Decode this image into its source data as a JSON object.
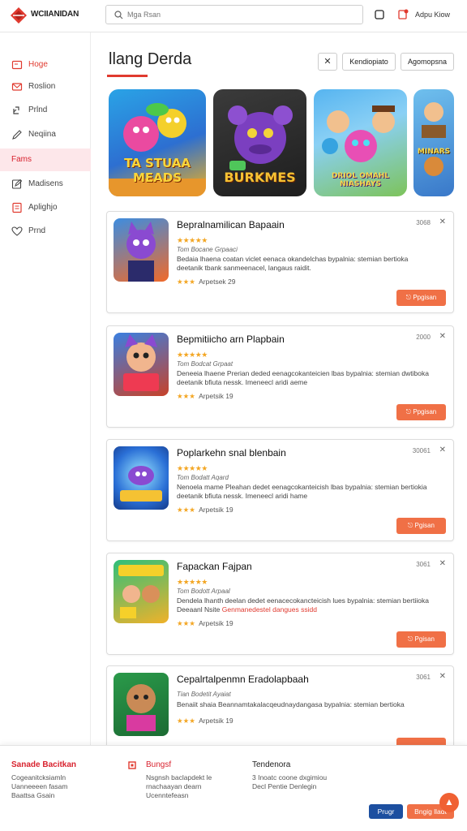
{
  "header": {
    "brand": "WCIIANIDAN",
    "search_placeholder": "Mga Rsan",
    "account_link": "Adpu Kiow"
  },
  "sidebar": {
    "items": [
      {
        "label": "Hoge",
        "icon": "home-icon"
      },
      {
        "label": "Roslion",
        "icon": "mail-icon"
      },
      {
        "label": "Prlnd",
        "icon": "link-icon"
      },
      {
        "label": "Neqiina",
        "icon": "pen-icon"
      },
      {
        "label": "Fams",
        "icon": ""
      },
      {
        "label": "Madisens",
        "icon": "edit-icon"
      },
      {
        "label": "Aplighjo",
        "icon": "document-icon"
      },
      {
        "label": "Prnd",
        "icon": "heart-icon"
      }
    ]
  },
  "main": {
    "title": "llang Derda",
    "buttons": [
      "Kendiopiato",
      "Agomopsna"
    ],
    "featured": [
      {
        "caption": "TA STUAA MEADS"
      },
      {
        "caption": "BURKMES"
      },
      {
        "caption": "DRIOL OMAHL NIASHAYS"
      },
      {
        "caption": "MINARS"
      }
    ],
    "cards": [
      {
        "title": "Bepralnamilican Bapaain",
        "stars": "★★★★★",
        "sub": "Tom Bocane Grpaaci",
        "desc_1": "Bedaia lhaena coatan viclet eenaca okandelchas bypalnia: stemian bertioka",
        "desc_2": "deetanik tbank sanmeenacel, langaus raidit.",
        "desc_highlight": "",
        "rating_stars": "★★★",
        "rating_text": "Arpetsek 29",
        "count": "3068",
        "action": "Ppgisan"
      },
      {
        "title": "Bepmitiicho arn Plapbain",
        "stars": "★★★★★",
        "sub": "Tom Bodcat Grpaat",
        "desc_1": "Deneeia lhaene Prerian deded eenagcokanteicien lbas bypalnia: stemian dwtiboka",
        "desc_2": "deetanik bfiuta nessk. Imeneecl aridi aeme",
        "desc_highlight": "",
        "rating_stars": "★★★",
        "rating_text": "Arpetsik 19",
        "count": "2000",
        "action": "Ppgisan"
      },
      {
        "title": "Poplarkehn snal blenbain",
        "stars": "★★★★★",
        "sub": "Tom Bodatt Aqard",
        "desc_1": "Nenoela mame Pleahan dedet eenagcokanteicish lbas bypalnia: stemian bertiokia",
        "desc_2": "deetanik bfiuta nessk. Imeneecl aridi hame",
        "desc_highlight": "",
        "rating_stars": "★★★",
        "rating_text": "Arpetsik 19",
        "count": "30061",
        "action": "Pgisan"
      },
      {
        "title": "Fapackan Fajpan",
        "stars": "★★★★★",
        "sub": "Tom Bodott Arpaal",
        "desc_1": "Dendela lhanth deelan dedet eenacecokancteicish lues bypalnia: stemian bertiioka",
        "desc_2": "Deeaanl Nsite ",
        "desc_highlight": "Genmanedestel dangues ssidd",
        "rating_stars": "★★★",
        "rating_text": "Arpetsik 19",
        "count": "3061",
        "action": "Pgisan"
      },
      {
        "title": "Cepalrtalpenmn Eradolapbaah",
        "stars": "",
        "sub": "Tian Bodetit Ayaiat",
        "desc_1": "Benaiit shaia Beannamtakalacqeudnaydangasa bypalnia: stemian bertioka",
        "desc_2": "",
        "desc_highlight": "",
        "rating_stars": "★★★",
        "rating_text": "Arpetsik 19",
        "count": "3061",
        "action": ""
      }
    ]
  },
  "footer": {
    "col1": {
      "title": "Sanade Bacitkan",
      "lines": [
        "Cogeanitcksiamln",
        "Uanneeeen fasam",
        "Baattsa Gsain"
      ]
    },
    "col2": {
      "title": "Bungsf",
      "lines": [
        "Nsgnsh baclapdekt le",
        "rnachaayan dearn",
        "Ucenntefeasn"
      ]
    },
    "col3": {
      "title": "Tendenora",
      "lines": [
        "3 Inoatc coone dxgimiou",
        "Decl Pentie Denlegin"
      ]
    },
    "btn_primary": "Prugr",
    "btn_secondary": "Bngig lladt",
    "fab": "▲"
  },
  "colors": {
    "accent": "#e03a2f",
    "action": "#f07046",
    "primary": "#1c4fa0"
  }
}
